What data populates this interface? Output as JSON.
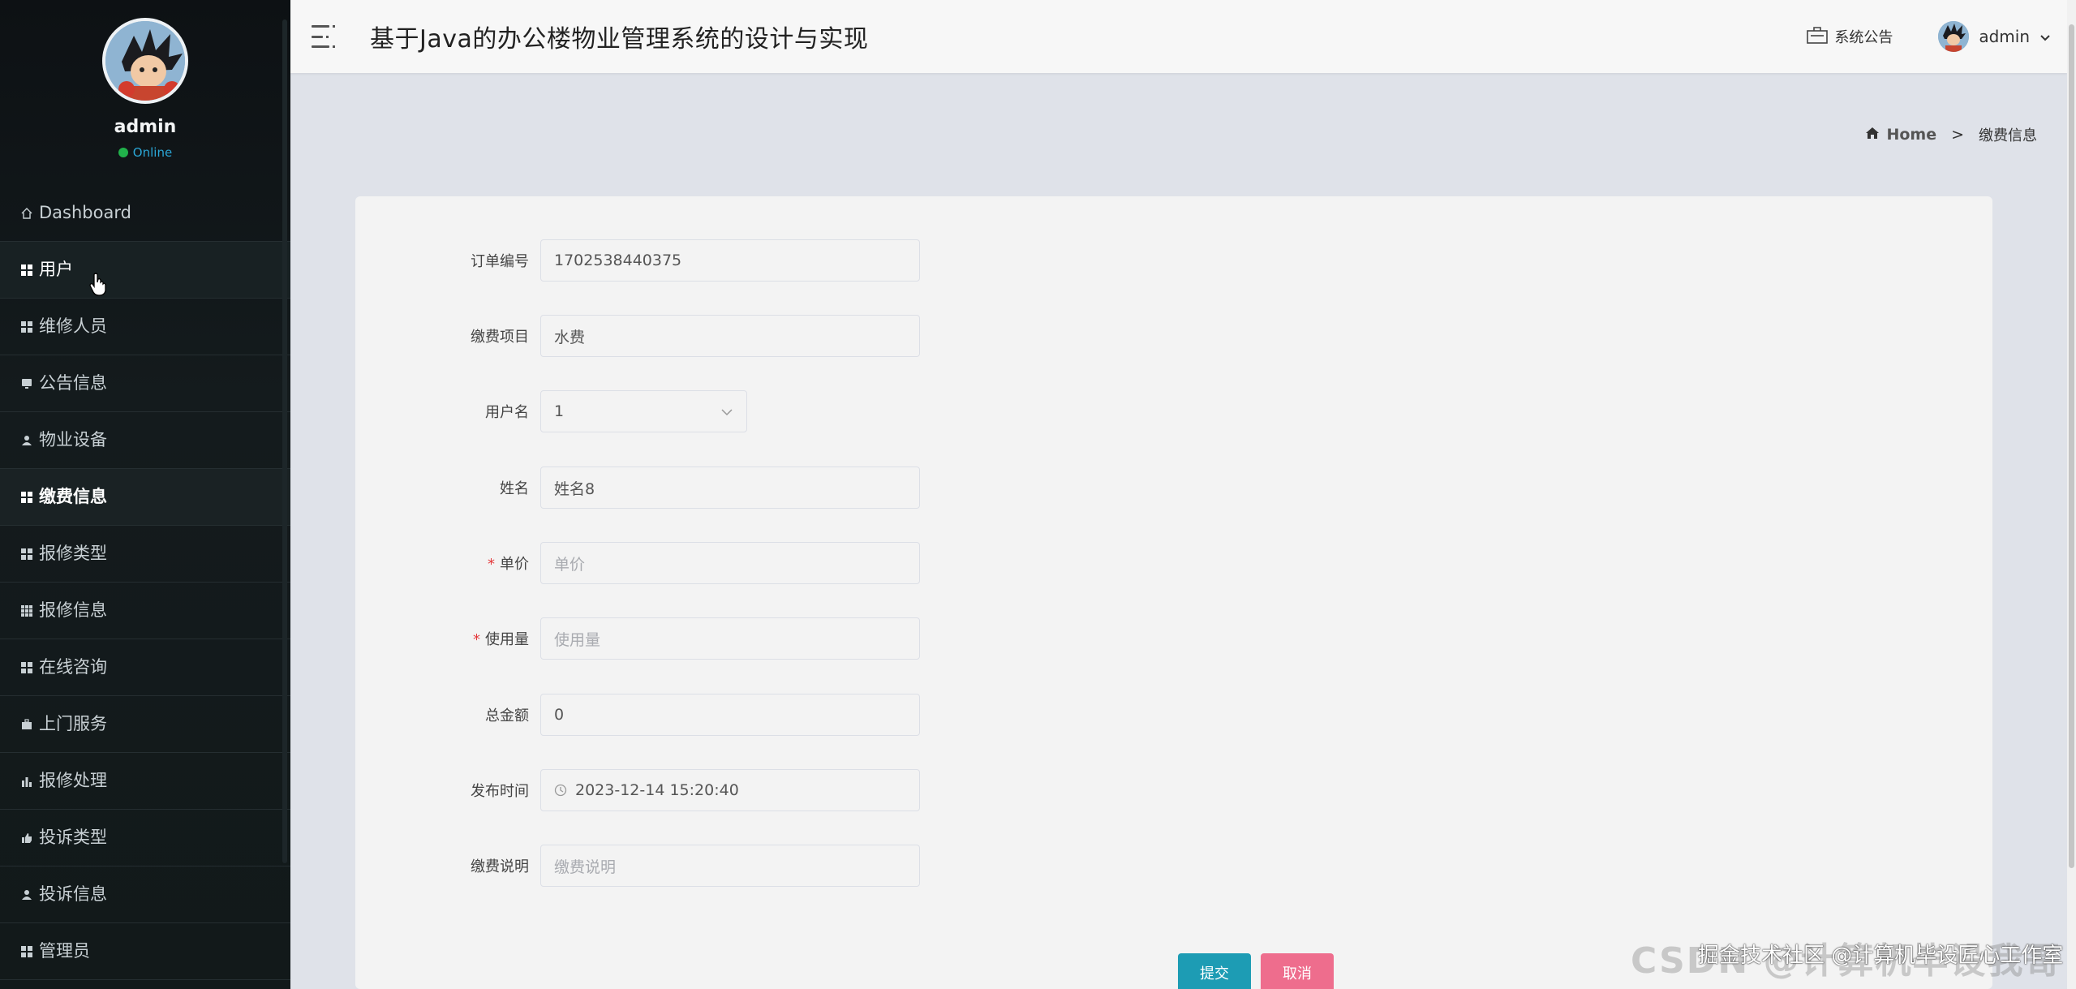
{
  "app": {
    "title": "基于Java的办公楼物业管理系统的设计与实现"
  },
  "sidebar": {
    "profile": {
      "name": "admin",
      "status": "Online"
    },
    "items": [
      {
        "label": "Dashboard",
        "icon": "home-icon"
      },
      {
        "label": "用户",
        "icon": "grid-icon"
      },
      {
        "label": "维修人员",
        "icon": "grid-icon"
      },
      {
        "label": "公告信息",
        "icon": "monitor-icon"
      },
      {
        "label": "物业设备",
        "icon": "user-icon"
      },
      {
        "label": "缴费信息",
        "icon": "grid-icon"
      },
      {
        "label": "报修类型",
        "icon": "grid-icon"
      },
      {
        "label": "报修信息",
        "icon": "table-icon"
      },
      {
        "label": "在线咨询",
        "icon": "grid-icon"
      },
      {
        "label": "上门服务",
        "icon": "briefcase-icon"
      },
      {
        "label": "报修处理",
        "icon": "bar-chart-icon"
      },
      {
        "label": "投诉类型",
        "icon": "thumbs-up-icon"
      },
      {
        "label": "投诉信息",
        "icon": "user-icon"
      },
      {
        "label": "管理员",
        "icon": "grid-icon"
      }
    ]
  },
  "topbar": {
    "notice_label": "系统公告",
    "user_label": "admin"
  },
  "breadcrumb": {
    "home": "Home",
    "separator": ">",
    "current": "缴费信息"
  },
  "form": {
    "order_no": {
      "label": "订单编号",
      "value": "1702538440375"
    },
    "item": {
      "label": "缴费项目",
      "value": "水费"
    },
    "username": {
      "label": "用户名",
      "value": "1"
    },
    "name": {
      "label": "姓名",
      "value": "姓名8"
    },
    "unit_price": {
      "label": "单价",
      "placeholder": "单价",
      "required": "*"
    },
    "usage": {
      "label": "使用量",
      "placeholder": "使用量",
      "required": "*"
    },
    "total": {
      "label": "总金额",
      "value": "0"
    },
    "publish_time": {
      "label": "发布时间",
      "value": "2023-12-14 15:20:40"
    },
    "remark": {
      "label": "缴费说明",
      "placeholder": "缴费说明"
    },
    "submit_label": "提交",
    "cancel_label": "取消"
  },
  "watermark": {
    "back_text": "CSDN @计算机毕设我哥",
    "front_text": "掘金技术社区 @计算机毕设匠心工作室"
  },
  "colors": {
    "sidebar_bg": "#12191a",
    "submit": "#1d9cb4",
    "cancel": "#ee6d8d",
    "online": "#21b24b",
    "required": "#e4393c"
  }
}
